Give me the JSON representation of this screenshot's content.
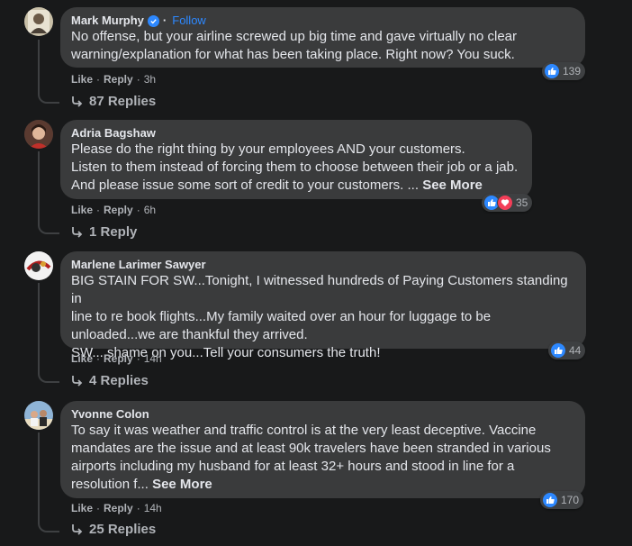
{
  "comments": [
    {
      "author": "Mark Murphy",
      "verified": true,
      "follow_label": "Follow",
      "lines": [
        "No offense, but your airline screwed up big time and gave virtually no clear",
        "warning/explanation for what has been taking place. Right now? You suck."
      ],
      "see_more": "",
      "reaction_count": "139",
      "reactions": [
        "like"
      ],
      "like_label": "Like",
      "reply_label": "Reply",
      "time": "3h",
      "replies": "87 Replies"
    },
    {
      "author": "Adria Bagshaw",
      "verified": false,
      "lines": [
        "Please do the right thing by your employees AND your customers.",
        "Listen to them instead of forcing them to choose between their job or a jab.",
        "And please issue some sort of credit to your customers. ..."
      ],
      "see_more": "See More",
      "reaction_count": "35",
      "reactions": [
        "like",
        "love"
      ],
      "like_label": "Like",
      "reply_label": "Reply",
      "time": "6h",
      "replies": "1 Reply"
    },
    {
      "author": "Marlene Larimer Sawyer",
      "verified": false,
      "lines": [
        "BIG STAIN FOR SW...Tonight, I witnessed hundreds of Paying Customers standing in",
        "line to re book flights...My family waited over an hour for luggage to be",
        "unloaded...we are thankful they arrived.",
        "SW....shame on you...Tell your consumers the truth!"
      ],
      "see_more": "",
      "reaction_count": "44",
      "reactions": [
        "like"
      ],
      "like_label": "Like",
      "reply_label": "Reply",
      "time": "14h",
      "replies": "4 Replies"
    },
    {
      "author": "Yvonne Colon",
      "verified": false,
      "lines": [
        "To say it was weather and traffic control is at the very least deceptive. Vaccine",
        "mandates are the issue and at least 90k travelers have been stranded in various",
        "airports including my husband for at least 32+ hours and stood in line for a",
        "resolution f..."
      ],
      "see_more": "See More",
      "reaction_count": "170",
      "reactions": [
        "like"
      ],
      "like_label": "Like",
      "reply_label": "Reply",
      "time": "14h",
      "replies": "25 Replies"
    }
  ],
  "colors": {
    "background": "#18191a",
    "bubble": "#3a3b3c",
    "text": "#e4e6eb",
    "secondary": "#b0b3b8",
    "like_blue": "#2d88ff",
    "love_red": "#f33e58"
  },
  "icons": {
    "verified": "verified-badge-icon",
    "like": "like-thumb-icon",
    "love": "love-heart-icon",
    "reply_arrow": "reply-arrow-icon"
  }
}
